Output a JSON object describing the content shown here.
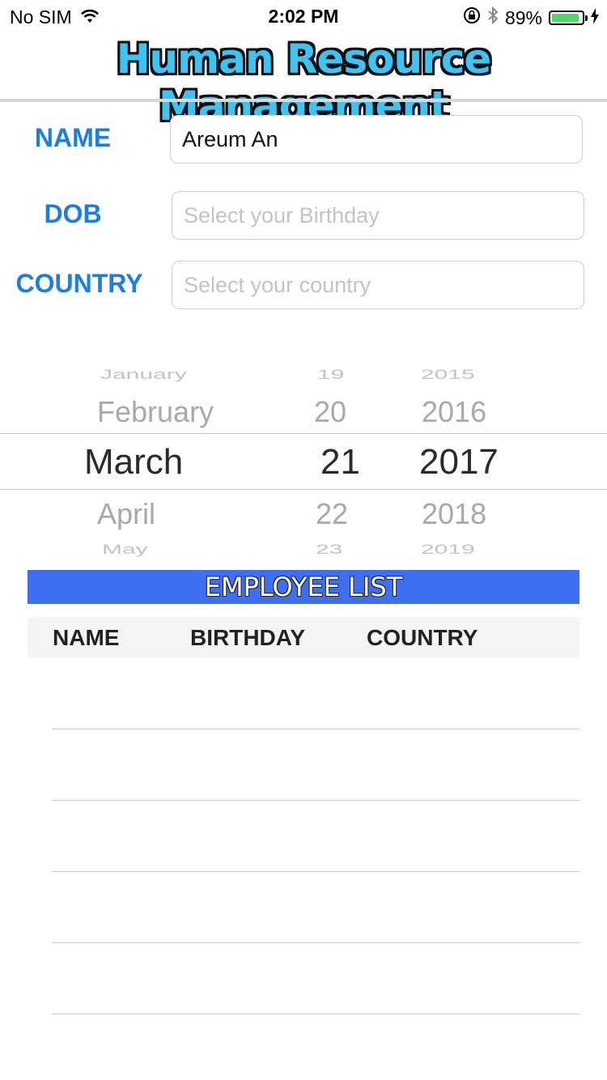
{
  "status_bar": {
    "carrier": "No SIM",
    "time": "2:02 PM",
    "battery_percent": "89%",
    "battery_level": 0.89
  },
  "app": {
    "title": "Human Resource Management"
  },
  "form": {
    "name_label": "NAME",
    "name_value": "Areum An",
    "dob_label": "DOB",
    "dob_placeholder": "Select your Birthday",
    "country_label": "COUNTRY",
    "country_placeholder": "Select your country"
  },
  "date_picker": {
    "months": [
      "January",
      "February",
      "March",
      "April",
      "May"
    ],
    "days": [
      "19",
      "20",
      "21",
      "22",
      "23"
    ],
    "years": [
      "2015",
      "2016",
      "2017",
      "2018",
      "2019"
    ],
    "selected": {
      "month": "March",
      "day": "21",
      "year": "2017"
    }
  },
  "employee_list": {
    "title": "EMPLOYEE LIST",
    "columns": [
      "NAME",
      "BIRTHDAY",
      "COUNTRY"
    ],
    "rows": []
  }
}
